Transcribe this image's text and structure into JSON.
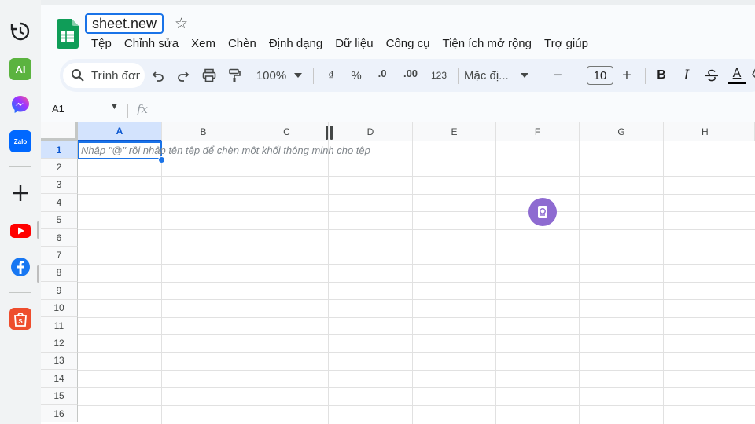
{
  "sidebar": {
    "items": [
      {
        "name": "history",
        "icon": "history-icon"
      },
      {
        "name": "ai",
        "icon": "ai-icon",
        "label": "AI"
      },
      {
        "name": "messenger",
        "icon": "messenger-icon"
      },
      {
        "name": "zalo",
        "icon": "zalo-icon",
        "label": "Zalo"
      },
      {
        "name": "add",
        "icon": "plus-icon"
      },
      {
        "name": "youtube",
        "icon": "youtube-icon"
      },
      {
        "name": "facebook",
        "icon": "facebook-icon"
      },
      {
        "name": "shopee",
        "icon": "shopee-icon"
      }
    ]
  },
  "document": {
    "title": "sheet.new"
  },
  "menu": {
    "items": [
      "Tệp",
      "Chỉnh sửa",
      "Xem",
      "Chèn",
      "Định dạng",
      "Dữ liệu",
      "Công cụ",
      "Tiện ích mở rộng",
      "Trợ giúp"
    ]
  },
  "toolbar": {
    "search_text": "Trình đơn",
    "zoom": "100%",
    "currency": "₫",
    "percent": "%",
    "decrease_decimal": ".0",
    "increase_decimal": ".00",
    "number_format": "123",
    "font": "Mặc đị...",
    "minus": "−",
    "font_size": "10",
    "plus": "+",
    "bold": "B",
    "italic": "I",
    "strike": "S",
    "text_color": "A"
  },
  "formula_bar": {
    "cell_ref": "A1",
    "fx": "fx"
  },
  "grid": {
    "columns": [
      "A",
      "B",
      "C",
      "D",
      "E",
      "F",
      "G",
      "H"
    ],
    "rows": [
      "1",
      "2",
      "3",
      "4",
      "5",
      "6",
      "7",
      "8",
      "9",
      "10",
      "11",
      "12",
      "13",
      "14",
      "15",
      "16"
    ],
    "selected_column": "A",
    "selected_row": "1",
    "hint_text": "Nhập \"@\" rồi nhập tên tệp để chèn một khối thông minh cho tệp"
  },
  "colors": {
    "accent": "#1a73e8",
    "sheets_green": "#0f9d58",
    "toolbar_bg": "#edf2fa"
  }
}
